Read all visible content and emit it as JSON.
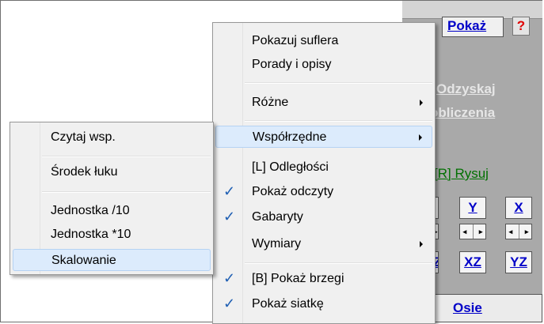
{
  "side_panel": {
    "show_link": "Pokaż",
    "help_label": "?",
    "recover_link_lines": [
      "Odzyskaj",
      "obliczenia"
    ],
    "draw_link": "[R] Rysuj",
    "axis_buttons": [
      "Y",
      "X",
      "XZ",
      "YZ"
    ],
    "partial_left_buttons": [
      "",
      "Z"
    ],
    "axes_link": "Osie"
  },
  "main_menu": {
    "items": [
      {
        "label": "Pokazuj suflera",
        "checked": false,
        "submenu": false
      },
      {
        "label": "Porady i opisy",
        "checked": false,
        "submenu": false
      },
      {
        "label": "Różne",
        "checked": false,
        "submenu": true
      },
      {
        "label": "Współrzędne",
        "checked": false,
        "submenu": true,
        "highlighted": true
      },
      {
        "label": "[L] Odległości",
        "checked": false,
        "submenu": false
      },
      {
        "label": "Pokaż odczyty",
        "checked": true,
        "submenu": false
      },
      {
        "label": "Gabaryty",
        "checked": true,
        "submenu": false
      },
      {
        "label": "Wymiary",
        "checked": false,
        "submenu": true
      },
      {
        "label": "[B] Pokaż brzegi",
        "checked": true,
        "submenu": false
      },
      {
        "label": "Pokaż siatkę",
        "checked": true,
        "submenu": false
      }
    ]
  },
  "sub_menu": {
    "items": [
      {
        "label": "Czytaj wsp."
      },
      {
        "label": "Środek łuku"
      },
      {
        "label": "Jednostka /10"
      },
      {
        "label": "Jednostka *10"
      },
      {
        "label": "Skalowanie",
        "highlighted": true
      }
    ]
  },
  "colors": {
    "menu_bg": "#f0f0f0",
    "highlight_bg": "#dcebfc",
    "check_color": "#1f5fb3",
    "link_blue": "#0000c8",
    "link_green": "#007000",
    "disabled_link": "#e6e6e6",
    "panel_gray": "#a9a9a9"
  },
  "icons": {
    "check": "check-icon",
    "submenu_arrow": "chevron-right-icon",
    "stepper": "stepper-arrows-icon"
  }
}
